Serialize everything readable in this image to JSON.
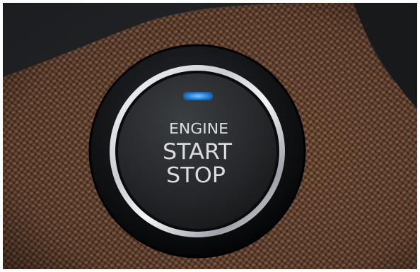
{
  "button": {
    "line1": "ENGINE",
    "line2": "START",
    "line3": "STOP"
  },
  "colors": {
    "fabric_brown": "#6b4a36",
    "fabric_dark": "#3a2519",
    "panel_black": "#0e0f11",
    "chrome_ring": "#e8eaee",
    "button_face": "#2a2c2f",
    "indicator_blue": "#2f8fe6",
    "label_text": "#d9dde2"
  }
}
